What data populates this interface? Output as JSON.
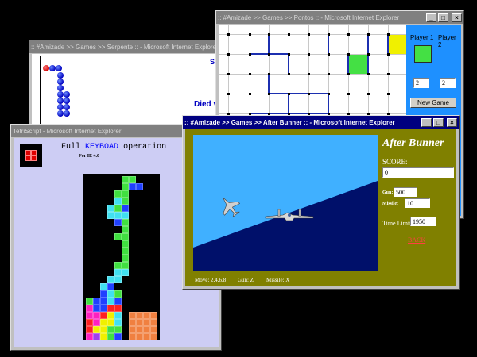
{
  "snake_window": {
    "title": ":: #Amizade >> Games >> Serpente :: - Microsoft Internet Explorer",
    "score_label_fragment": "Sr",
    "status_fragment": "Died v"
  },
  "pontos_window": {
    "title": ":: #Amizade >> Games >> Pontos :: - Microsoft Internet Explorer",
    "player1_label": "Player 1",
    "player2_label": "Player 2",
    "player1_score": "2",
    "player2_score": "2",
    "new_game_label": "New Game",
    "colors": {
      "player1": "#44e044",
      "player2": "#f0f000",
      "panel": "#1e90ff"
    }
  },
  "tetris_window": {
    "title": "TetriScript - Microsoft Internet Explorer",
    "heading_prefix": "Full",
    "heading_keyword": "KEYBOAD",
    "heading_suffix": "operation",
    "subheading": "For IE 4.0"
  },
  "bunner_window": {
    "title": ":: #Amizade >> Games >> After Bunner :: - Microsoft Internet Explorer",
    "game_title": "After Bunner",
    "score_label": "SCORE:",
    "score_value": "0",
    "gun_label": "Gun:",
    "gun_value": "500",
    "missile_label": "Missile:",
    "missile_value": "10",
    "time_label": "Time Limit:",
    "time_value": "1950",
    "back_label": "BACK",
    "controls": {
      "move": "Move: 2,4,6,8",
      "gun": "Gun: Z",
      "missile": "Missile: X"
    },
    "colors": {
      "panel": "#808000",
      "sky": "#40b0ff",
      "ground": "#00106a"
    }
  },
  "window_buttons": {
    "minimize": "_",
    "maximize": "□",
    "close": "×"
  }
}
